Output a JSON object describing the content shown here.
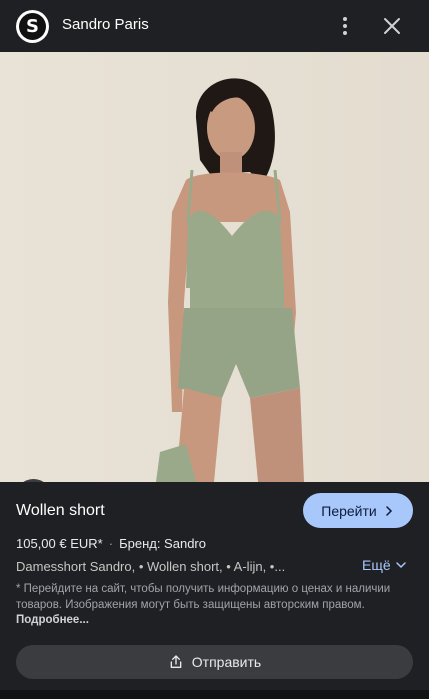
{
  "header": {
    "logo_letter": "S",
    "site_name": "Sandro Paris"
  },
  "product": {
    "title": "Wollen short",
    "price": "105,00 € EUR*",
    "brand": "Бренд: Sandro",
    "tags": "Damesshort Sandro, • Wollen short, • A-lijn, •...",
    "visit_label": "Перейти",
    "more_label": "Ещё",
    "disclaimer": "* Перейдите на сайт, чтобы получить информацию о ценах и наличии товаров. Изображения могут быть защищены авторским правом.",
    "disclaimer_link": "Подробнее...",
    "share_label": "Отправить"
  },
  "colors": {
    "background": "#1f2023",
    "accent": "#a8c7fa",
    "garment": "#9aa98a"
  },
  "icons": [
    "more-vert-icon",
    "close-icon",
    "lens-icon",
    "chevron-right-icon",
    "chevron-down-icon",
    "share-icon"
  ]
}
